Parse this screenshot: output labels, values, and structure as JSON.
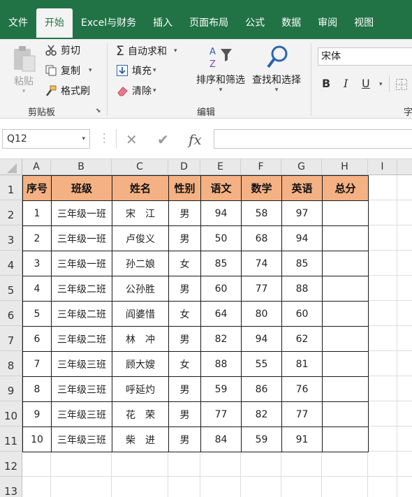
{
  "tabs": [
    "文件",
    "开始",
    "Excel与财务",
    "插入",
    "页面布局",
    "公式",
    "数据",
    "审阅",
    "视图"
  ],
  "active_tab": "开始",
  "clipboard": {
    "paste": "粘贴",
    "cut": "剪切",
    "copy": "复制",
    "format_painter": "格式刷",
    "label": "剪贴板"
  },
  "editing": {
    "autosum": "自动求和",
    "fill": "填充",
    "clear": "清除",
    "sort_filter": "排序和筛选",
    "find_select": "查找和选择",
    "label": "编辑"
  },
  "font": {
    "name": "宋体",
    "bold": "B",
    "italic": "I",
    "underline": "U",
    "label": "字"
  },
  "formula_bar": {
    "name_box": "Q12",
    "cancel": "✕",
    "enter": "✔",
    "fx": "fx",
    "formula": ""
  },
  "columns": [
    "A",
    "B",
    "C",
    "D",
    "E",
    "F",
    "G",
    "H",
    "I"
  ],
  "rows": [
    "1",
    "2",
    "3",
    "4",
    "5",
    "6",
    "7",
    "8",
    "9",
    "10",
    "11",
    "12",
    "13"
  ],
  "table": {
    "headers": [
      "序号",
      "班级",
      "姓名",
      "性别",
      "语文",
      "数学",
      "英语",
      "总分"
    ],
    "rows": [
      [
        "1",
        "三年级一班",
        "宋　江",
        "男",
        "94",
        "58",
        "97",
        ""
      ],
      [
        "2",
        "三年级一班",
        "卢俊义",
        "男",
        "50",
        "68",
        "94",
        ""
      ],
      [
        "3",
        "三年级一班",
        "孙二娘",
        "女",
        "85",
        "74",
        "85",
        ""
      ],
      [
        "4",
        "三年级二班",
        "公孙胜",
        "男",
        "60",
        "77",
        "88",
        ""
      ],
      [
        "5",
        "三年级二班",
        "阎婆惜",
        "女",
        "64",
        "80",
        "60",
        ""
      ],
      [
        "6",
        "三年级二班",
        "林　冲",
        "男",
        "82",
        "94",
        "62",
        ""
      ],
      [
        "7",
        "三年级三班",
        "顾大嫂",
        "女",
        "88",
        "55",
        "81",
        ""
      ],
      [
        "8",
        "三年级三班",
        "呼延灼",
        "男",
        "59",
        "86",
        "76",
        ""
      ],
      [
        "9",
        "三年级三班",
        "花　荣",
        "男",
        "77",
        "82",
        "77",
        ""
      ],
      [
        "10",
        "三年级三班",
        "柴　进",
        "男",
        "84",
        "59",
        "91",
        ""
      ]
    ]
  },
  "colors": {
    "brand": "#217346",
    "header_fill": "#f4b183"
  }
}
